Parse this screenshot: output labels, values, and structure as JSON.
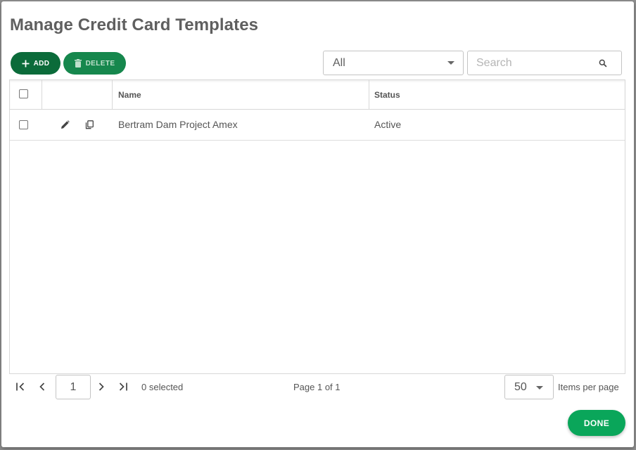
{
  "dialog": {
    "title": "Manage Credit Card Templates"
  },
  "toolbar": {
    "add_label": "ADD",
    "delete_label": "DELETE",
    "filter_value": "All",
    "search_placeholder": "Search",
    "search_value": ""
  },
  "table": {
    "columns": [
      "",
      "",
      "Name",
      "Status"
    ],
    "rows": [
      {
        "name": "Bertram Dam Project Amex",
        "status": "Active"
      }
    ]
  },
  "pager": {
    "current_page": "1",
    "selected_text": "0 selected",
    "page_info": "Page 1 of 1",
    "items_per_page_value": "50",
    "items_per_page_label": "Items per page"
  },
  "footer": {
    "done_label": "DONE"
  },
  "colors": {
    "add_button": "#0b6b3a",
    "delete_button": "#16874d",
    "done_button": "#0aa65a",
    "title_text": "#5f5f5f"
  },
  "icons": {
    "add": "plus-icon",
    "delete": "trash-icon",
    "filter": "caret-down-icon",
    "search": "search-icon",
    "edit": "pencil-icon",
    "copy": "copy-icon",
    "first": "first-page-icon",
    "prev": "chevron-left-icon",
    "next": "chevron-right-icon",
    "last": "last-page-icon"
  }
}
